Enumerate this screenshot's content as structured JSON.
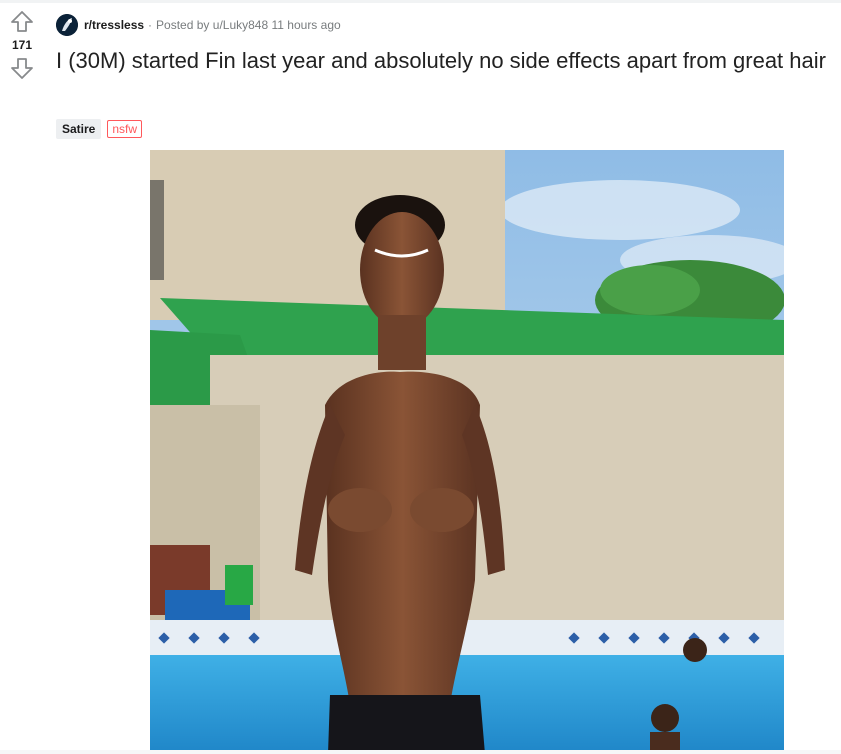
{
  "vote": {
    "count": "171",
    "upvote_icon": "arrow-up-outline",
    "downvote_icon": "arrow-down-outline"
  },
  "post": {
    "subreddit": "r/tressless",
    "separator": "·",
    "posted_by_prefix": "Posted by",
    "author": "u/Luky848",
    "age": "11 hours ago",
    "title": "I (30M) started Fin last year and absolutely no side effects apart from great hair",
    "flairs": {
      "primary": "Satire",
      "nsfw": "nsfw"
    }
  },
  "colors": {
    "nsfw": "#ff585b",
    "flair_bg": "#edeff1",
    "meta_text": "#787c7e",
    "arrow": "#878a8c"
  }
}
